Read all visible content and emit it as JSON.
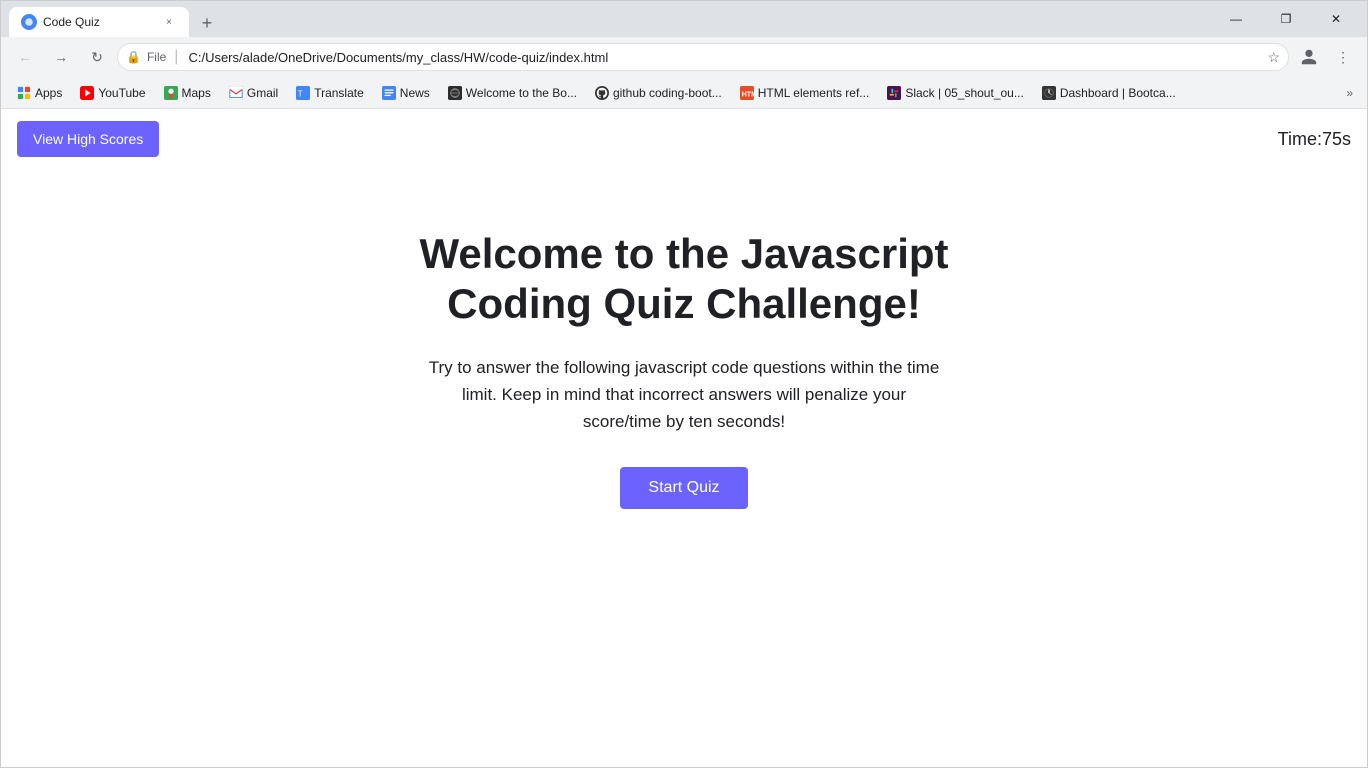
{
  "window": {
    "title": "Code Quiz",
    "tab_close_label": "×",
    "new_tab_label": "+",
    "minimize": "—",
    "maximize": "❐",
    "close": "✕"
  },
  "nav": {
    "back_label": "←",
    "forward_label": "→",
    "refresh_label": "↻",
    "address": "C:/Users/alade/OneDrive/Documents/my_class/HW/code-quiz/index.html",
    "address_placeholder": "",
    "secure_label": "🔒",
    "star_label": "☆",
    "profile_label": "👤",
    "menu_label": "⋮",
    "more_label": "»"
  },
  "bookmarks": [
    {
      "id": "apps",
      "label": "Apps",
      "type": "apps"
    },
    {
      "id": "youtube",
      "label": "YouTube",
      "type": "yt"
    },
    {
      "id": "maps",
      "label": "Maps",
      "type": "maps"
    },
    {
      "id": "gmail",
      "label": "Gmail",
      "type": "gmail"
    },
    {
      "id": "translate",
      "label": "Translate",
      "type": "translate"
    },
    {
      "id": "news",
      "label": "News",
      "type": "news"
    },
    {
      "id": "welcome",
      "label": "Welcome to the Bo...",
      "type": "welcome"
    },
    {
      "id": "github",
      "label": "github coding-boot...",
      "type": "github"
    },
    {
      "id": "html-ref",
      "label": "HTML elements ref...",
      "type": "html"
    },
    {
      "id": "slack",
      "label": "Slack | 05_shout_ou...",
      "type": "slack"
    },
    {
      "id": "dashboard",
      "label": "Dashboard | Bootca...",
      "type": "bootcamp"
    }
  ],
  "page": {
    "view_high_scores_label": "View High Scores",
    "timer_label": "Time:",
    "timer_value": "75s",
    "quiz_title": "Welcome to the Javascript Coding Quiz Challenge!",
    "quiz_description": "Try to answer the following javascript code questions within the time limit. Keep in mind that incorrect answers will penalize your score/time by ten seconds!",
    "start_quiz_label": "Start Quiz"
  }
}
